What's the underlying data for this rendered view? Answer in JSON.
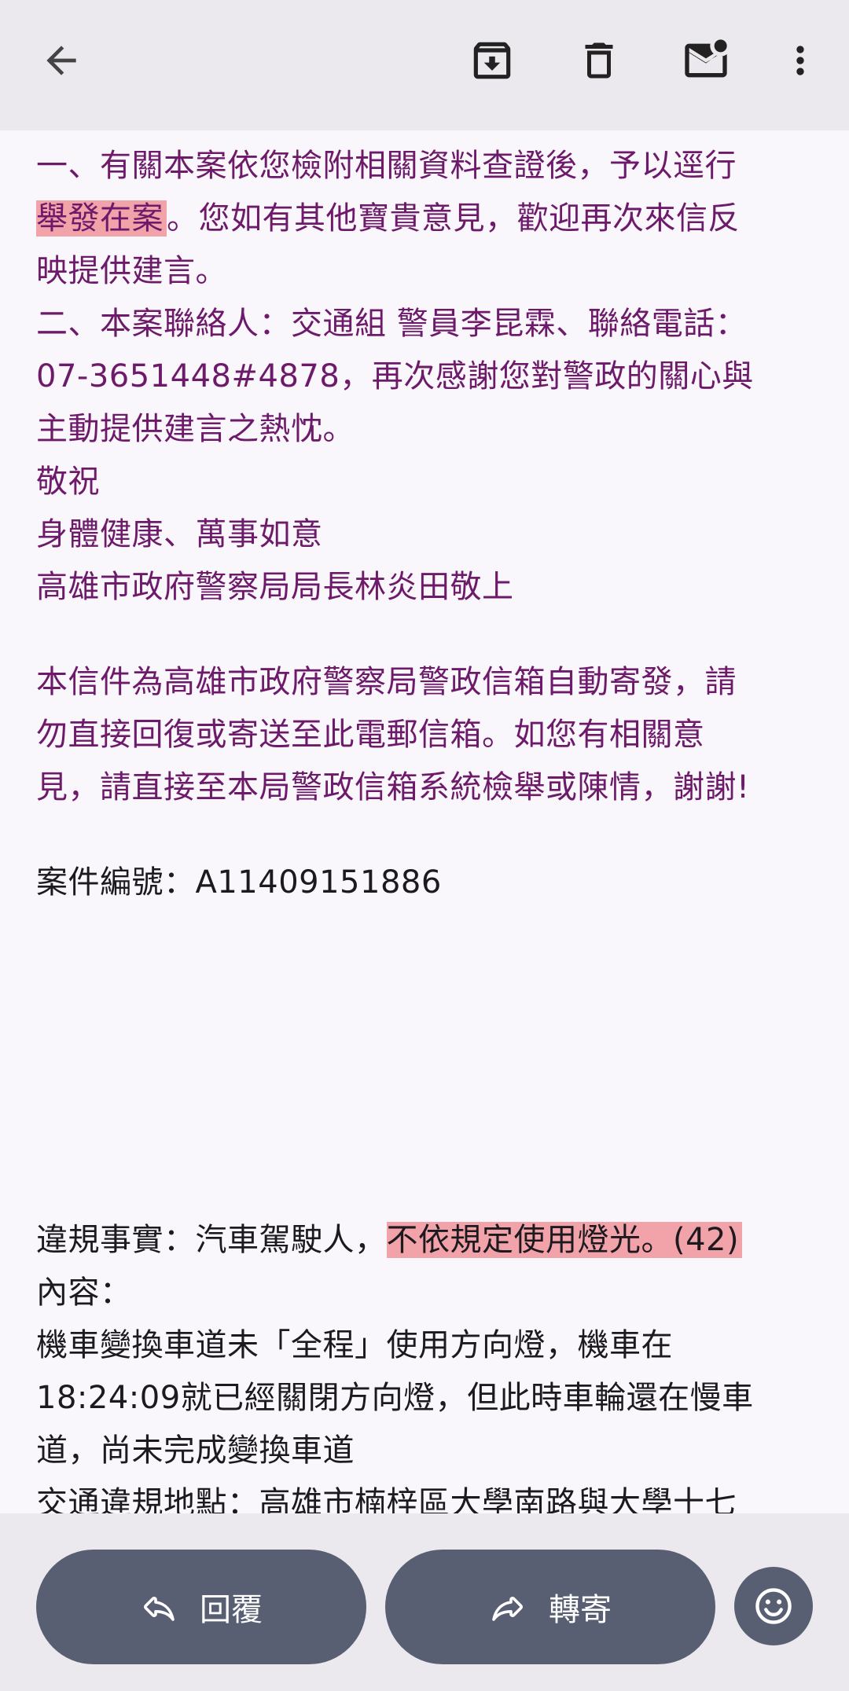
{
  "toolbar": {
    "back_icon": "arrow-left-icon",
    "archive_icon": "archive-icon",
    "delete_icon": "trash-icon",
    "mark_unread_icon": "mail-unread-icon",
    "more_icon": "more-vert-icon"
  },
  "body": {
    "p1": [
      "一、有關本案依您檢附相關資料查證後，予以逕行",
      "舉發在案",
      "。您如有其他寶貴意見，歡迎再次來信反",
      "映提供建言。"
    ],
    "p2": [
      "二、本案聯絡人：交通組 警員李昆霖、聯絡電話：",
      "07-3651448#4878，再次感謝您對警政的關心與",
      "主動提供建言之熱忱。"
    ],
    "closing": [
      "敬祝",
      "身體健康、萬事如意",
      "高雄市政府警察局局長林炎田敬上"
    ],
    "notice": [
      "本信件為高雄市政府警察局警政信箱自動寄發，請",
      "勿直接回復或寄送至此電郵信箱。如您有相關意",
      "見，請直接至本局警政信箱系統檢舉或陳情，謝謝!"
    ],
    "case_number": "案件編號：A11409151886",
    "violation_prefix": "違規事實：汽車駕駛人，",
    "violation_highlight": "不依規定使用燈光。(42)",
    "content_label": "內容：",
    "content_lines": [
      "機車變換車道未「全程」使用方向燈，機車在",
      "18:24:09就已經關閉方向燈，但此時車輪還在慢車",
      "道，尚未完成變換車道"
    ],
    "location_partial": "交通違規地點：高雄市楠梓區大學南路與大學十七"
  },
  "actions": {
    "reply_label": "回覆",
    "forward_label": "轉寄",
    "reply_icon": "reply-icon",
    "forward_icon": "forward-icon",
    "emoji_icon": "smiley-icon"
  },
  "colors": {
    "highlight": "#f2a3a9",
    "body_text": "#6e1a6b",
    "button_bg": "#595f73"
  }
}
